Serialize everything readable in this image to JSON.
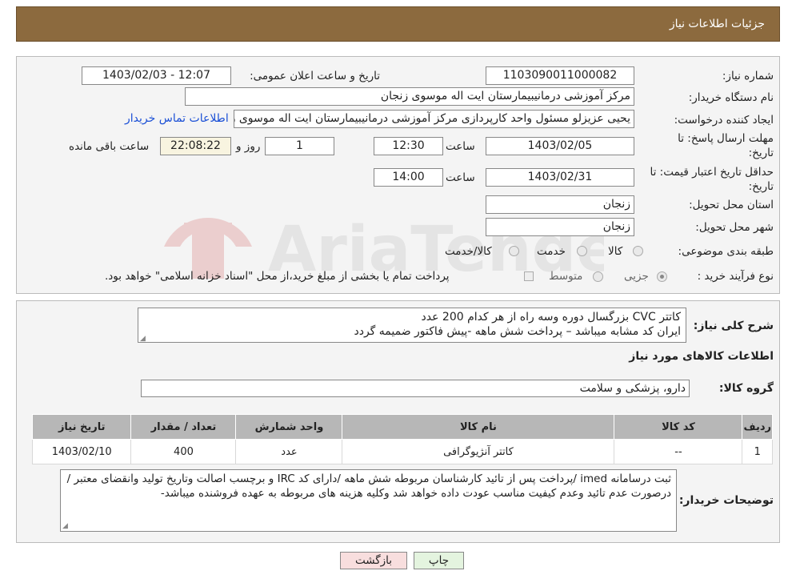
{
  "header": {
    "title": "جزئیات اطلاعات نیاز"
  },
  "form": {
    "need_number_label": "شماره نیاز:",
    "need_number": "1103090011000082",
    "announce_label": "تاریخ و ساعت اعلان عمومی:",
    "announce_value": "1403/02/03 - 12:07",
    "buyer_org_label": "نام دستگاه خریدار:",
    "buyer_org": "مرکز آموزشی درمانیبیمارستان ایت اله موسوی زنجان",
    "requester_label": "ایجاد کننده درخواست:",
    "requester": "یحیی عزیزلو مسئول واحد کارپردازی مرکز آموزشی درمانیبیمارستان ایت اله موسوی زنجان",
    "contact_link": "اطلاعات تماس خریدار",
    "deadline_label_1": "مهلت ارسال پاسخ: تا",
    "deadline_label_2": "تاریخ:",
    "deadline_date": "1403/02/05",
    "time_label": "ساعت",
    "deadline_time": "12:30",
    "days": "1",
    "days_label": "روز و",
    "remaining_time": "22:08:22",
    "remaining_label": "ساعت باقی مانده",
    "validity_label_1": "حداقل تاریخ اعتبار قیمت: تا",
    "validity_label_2": "تاریخ:",
    "validity_date": "1403/02/31",
    "validity_time": "14:00",
    "province_label": "استان محل تحویل:",
    "province": "زنجان",
    "city_label": "شهر محل تحویل:",
    "city": "زنجان",
    "category_label": "طبقه بندی موضوعی:",
    "category_options": [
      "کالا",
      "خدمت",
      "کالا/خدمت"
    ],
    "purchase_label": "نوع فرآیند خرید :",
    "purchase_options": [
      "جزیی",
      "متوسط"
    ],
    "purchase_note": "پرداخت تمام یا بخشی از مبلغ خرید،از محل \"اسناد خزانه اسلامی\" خواهد بود."
  },
  "summary": {
    "label": "شرح کلی نیاز:",
    "lines": [
      "کاتتر CVC بزرگسال دوره وسه راه از هر کدام 200 عدد",
      "ایران کد مشابه میباشد – پرداخت شش ماهه -پیش فاکتور ضمیمه گردد"
    ],
    "items_heading": "اطلاعات کالاهای مورد نیاز",
    "group_label": "گروه کالا:",
    "group_value": "دارو، پزشکی و سلامت"
  },
  "table": {
    "headers": [
      "ردیف",
      "کد کالا",
      "نام کالا",
      "واحد شمارش",
      "تعداد / مقدار",
      "تاریخ نیاز"
    ],
    "rows": [
      [
        "1",
        "--",
        "کاتتر آنژیوگرافی",
        "عدد",
        "400",
        "1403/02/10"
      ]
    ]
  },
  "notes": {
    "label": "توضیحات خریدار:",
    "text": "ثبت درسامانه imed /پرداخت پس از تائید کارشناسان مربوطه  شش ماهه /دارای کد IRC  و برچسب اصالت وتاریخ تولید وانقضای معتبر /درصورت عدم تائید وعدم کیفیت مناسب عودت داده خواهد شد وکلیه هزینه های مربوطه به عهده فروشنده میباشد-"
  },
  "buttons": {
    "print": "چاپ",
    "back": "بازگشت"
  },
  "watermark_text": "AriaTender.neT",
  "colors": {
    "header": "#8c6a3e",
    "link": "#1a4fd6",
    "back_button": "#f8dede",
    "print_button": "#e4f4df"
  }
}
